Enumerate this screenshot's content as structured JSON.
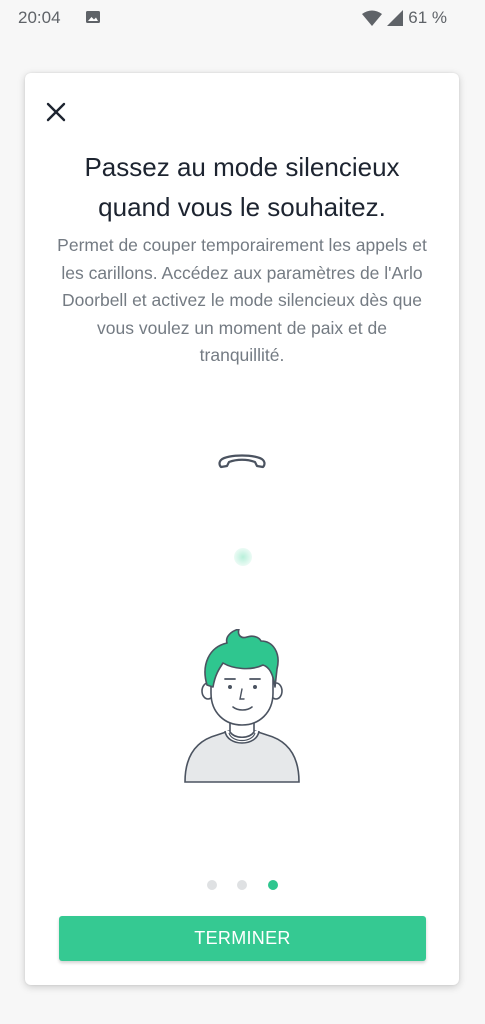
{
  "status_bar": {
    "time": "20:04",
    "battery": "61 %",
    "icons": [
      "image-icon",
      "wifi-icon",
      "signal-icon"
    ]
  },
  "modal": {
    "close_icon": "close-icon",
    "title": "Passez au mode silencieux quand vous le souhaitez.",
    "description": "Permet de couper temporairement les appels et les carillons. Accédez aux paramètres de l'Arlo Doorbell et activez le mode silencieux dès que vous voulez un moment de paix et de tranquillité.",
    "illustration": {
      "icons": [
        "phone-hangup-icon",
        "glow-dot-icon",
        "person-avatar-icon"
      ]
    },
    "pager": {
      "total": 3,
      "active_index": 3
    },
    "button_label": "TERMINER",
    "colors": {
      "accent": "#35c992",
      "title": "#1d2430",
      "body_text": "#747b83",
      "hair": "#2fc68f"
    }
  }
}
